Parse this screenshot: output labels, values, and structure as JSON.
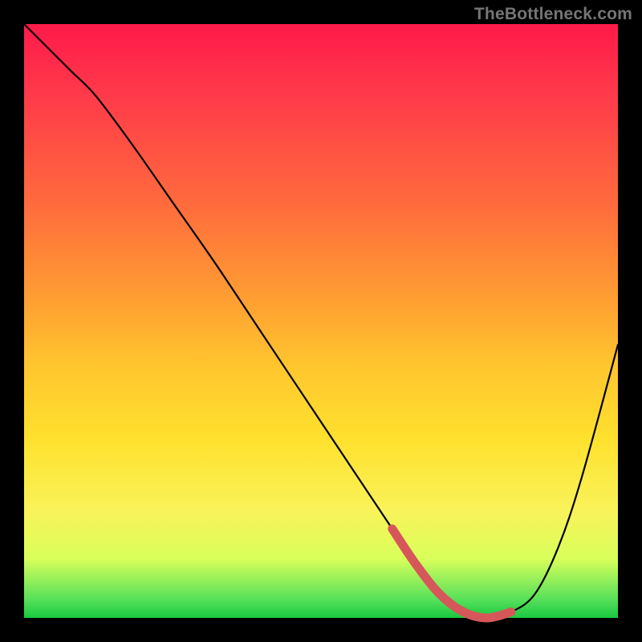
{
  "watermark": "TheBottleneck.com",
  "chart_data": {
    "type": "line",
    "title": "",
    "xlabel": "",
    "ylabel": "",
    "xlim": [
      0,
      100
    ],
    "ylim": [
      0,
      100
    ],
    "series": [
      {
        "name": "bottleneck-curve",
        "x": [
          0,
          4,
          8,
          12,
          18,
          25,
          32,
          40,
          48,
          56,
          62,
          66,
          70,
          74,
          78,
          82,
          86,
          90,
          94,
          100
        ],
        "values": [
          100,
          96,
          92,
          88,
          80,
          70,
          60,
          48,
          36,
          24,
          15,
          9,
          4,
          1,
          0,
          1,
          4,
          12,
          24,
          46
        ]
      }
    ],
    "accent_range_x": [
      62,
      84
    ],
    "colors": {
      "curve": "#000000",
      "accent": "#d6575a",
      "gradient_top": "#ff1a4a",
      "gradient_bottom": "#18c840"
    }
  }
}
